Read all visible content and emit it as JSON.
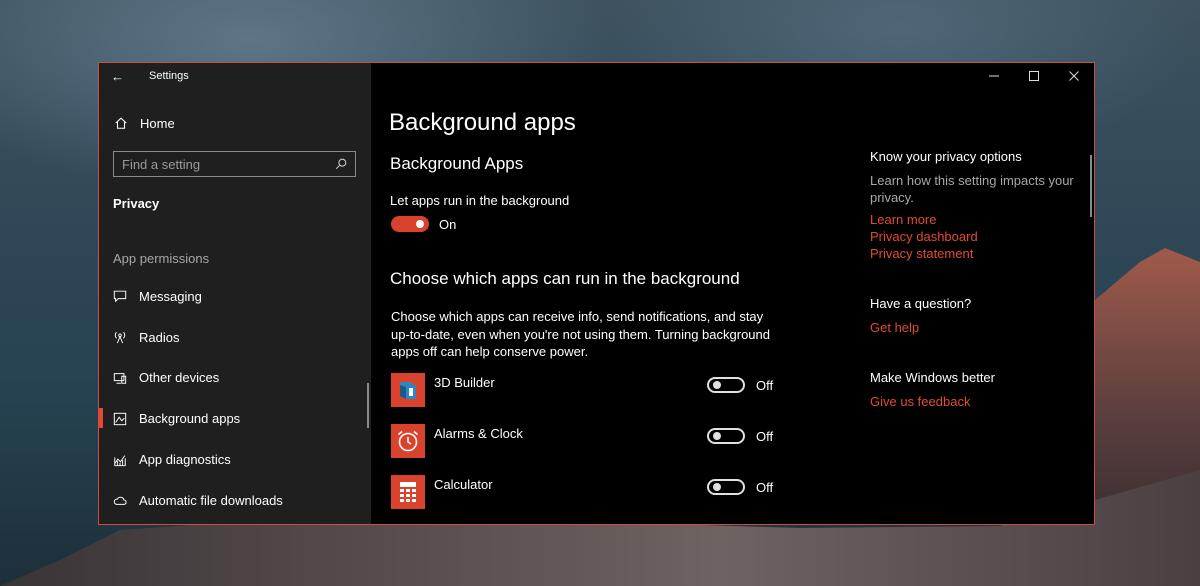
{
  "window": {
    "app_title": "Settings"
  },
  "sidebar": {
    "home_label": "Home",
    "search_placeholder": "Find a setting",
    "section_title": "Privacy",
    "group_header": "App permissions",
    "items": [
      {
        "label": "Messaging",
        "icon": "message-icon"
      },
      {
        "label": "Radios",
        "icon": "radio-tower-icon"
      },
      {
        "label": "Other devices",
        "icon": "devices-icon"
      },
      {
        "label": "Background apps",
        "icon": "background-apps-icon",
        "selected": true
      },
      {
        "label": "App diagnostics",
        "icon": "diagnostics-icon"
      },
      {
        "label": "Automatic file downloads",
        "icon": "cloud-icon"
      }
    ]
  },
  "content": {
    "page_title": "Background apps",
    "section1_title": "Background Apps",
    "setting_label": "Let apps run in the background",
    "master_toggle_state": "On",
    "section2_title": "Choose which apps can run in the background",
    "section2_desc": "Choose which apps can receive info, send notifications, and stay up-to-date, even when you're not using them. Turning background apps off can help conserve power.",
    "apps": [
      {
        "name": "3D Builder",
        "state": "Off",
        "icon": "3d-builder-icon"
      },
      {
        "name": "Alarms & Clock",
        "state": "Off",
        "icon": "alarm-clock-icon"
      },
      {
        "name": "Calculator",
        "state": "Off",
        "icon": "calculator-icon"
      }
    ]
  },
  "right_panel": {
    "privacy_heading": "Know your privacy options",
    "privacy_text": "Learn how this setting impacts your privacy.",
    "links": [
      "Learn more",
      "Privacy dashboard",
      "Privacy statement"
    ],
    "question_heading": "Have a question?",
    "help_link": "Get help",
    "better_heading": "Make Windows better",
    "feedback_link": "Give us feedback"
  },
  "colors": {
    "accent": "#d9432d",
    "sidebar_bg": "#1f1f1f",
    "content_bg": "#000000",
    "window_border": "#c9503f"
  }
}
